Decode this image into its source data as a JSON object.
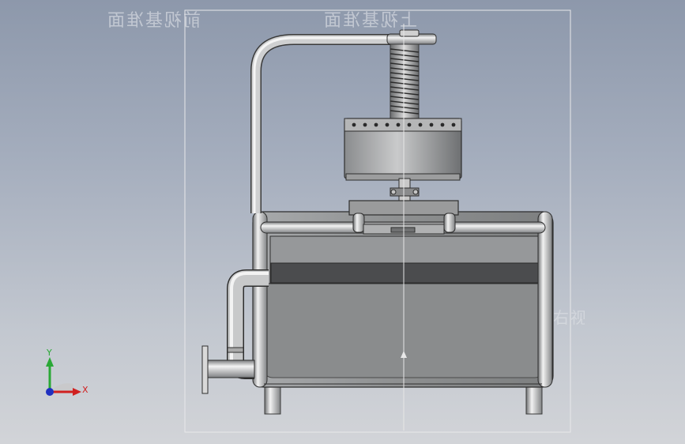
{
  "planes": {
    "front": "前视基准面",
    "top": "上视基准面",
    "right": "右视基准面"
  },
  "triad": {
    "y_label": "Y",
    "x_label": "X"
  },
  "colors": {
    "background_top": "#8d98ab",
    "background_bottom": "#d2d4d8",
    "triad_y": "#2aa836",
    "triad_x": "#d02020",
    "triad_z": "#2030c0"
  }
}
